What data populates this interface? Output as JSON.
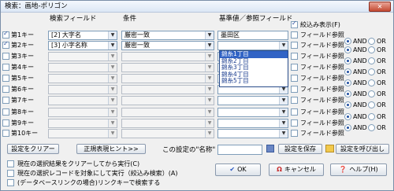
{
  "window": {
    "title": "検索：画地-ポリゴン",
    "close_label": "✕"
  },
  "headers": {
    "field": "検索フィールド",
    "condition": "条件",
    "value": "基準値／参照フィールド"
  },
  "narrow_display": {
    "label": "絞込み表示(F)",
    "checked": true
  },
  "field_ref_label": "フィールド参照",
  "and_label": "AND",
  "or_label": "OR",
  "keys": [
    {
      "label": "第1キー",
      "checked": true,
      "field": "[2] 大字名",
      "condition": "厳密一致",
      "value": "墨田区",
      "value_is_combo": false
    },
    {
      "label": "第2キー",
      "checked": true,
      "field": "[3] 小字名称",
      "condition": "厳密一致",
      "value": "",
      "value_is_combo": true
    },
    {
      "label": "第3キー",
      "checked": false,
      "field": "",
      "condition": "",
      "value": "",
      "value_is_combo": true
    },
    {
      "label": "第4キー",
      "checked": false,
      "field": "",
      "condition": "",
      "value": "",
      "value_is_combo": true
    },
    {
      "label": "第5キー",
      "checked": false,
      "field": "",
      "condition": "",
      "value": "",
      "value_is_combo": true
    },
    {
      "label": "第6キー",
      "checked": false,
      "field": "",
      "condition": "",
      "value": "",
      "value_is_combo": true
    },
    {
      "label": "第7キー",
      "checked": false,
      "field": "",
      "condition": "",
      "value": "",
      "value_is_combo": true
    },
    {
      "label": "第8キー",
      "checked": false,
      "field": "",
      "condition": "",
      "value": "",
      "value_is_combo": true
    },
    {
      "label": "第9キー",
      "checked": false,
      "field": "",
      "condition": "",
      "value": "",
      "value_is_combo": true
    },
    {
      "label": "第10キー",
      "checked": false,
      "field": "",
      "condition": "",
      "value": "",
      "value_is_combo": true
    }
  ],
  "dropdown_items": [
    "錦糸1丁目",
    "錦糸2丁目",
    "錦糸3丁目",
    "錦糸4丁目",
    "錦糸5丁目"
  ],
  "dropdown_selected": 0,
  "buttons": {
    "clear": "設定をクリアー",
    "regex_hint": "正規表現ヒント>>",
    "save": "設定を保存",
    "load": "設定を呼び出し",
    "ok": "OK",
    "cancel": "キャンセル",
    "help": "ヘルプ(H)"
  },
  "setting_name_label": "この設定の\"名称\"",
  "options": [
    {
      "label": "現在の選択結果をクリアーしてから実行(C)",
      "checked": false
    },
    {
      "label": "現在の選択レコードを対象にして実行（絞込み検索）(A)",
      "checked": false
    },
    {
      "label": "(データベースリンクの場合)リンクキーで検索する",
      "checked": false
    }
  ]
}
